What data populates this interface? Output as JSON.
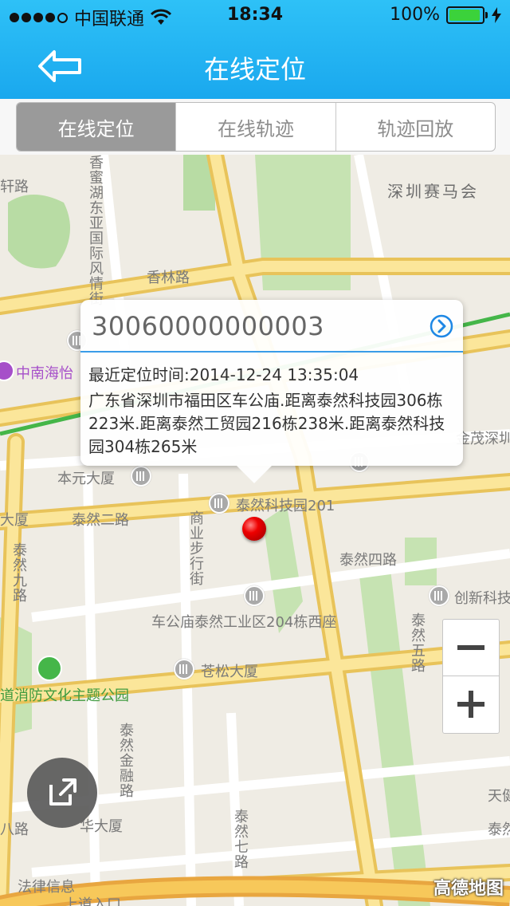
{
  "status_bar": {
    "carrier": "中国联通",
    "time": "18:34",
    "battery": "100%"
  },
  "nav": {
    "title": "在线定位",
    "back_icon": "back-arrow-icon"
  },
  "tabs": [
    {
      "label": "在线定位",
      "active": true
    },
    {
      "label": "在线轨迹",
      "active": false
    },
    {
      "label": "轨迹回放",
      "active": false
    }
  ],
  "popup": {
    "device_id": "30060000000003",
    "time_label": "最近定位时间:2014-12-24 13:35:04",
    "address": "广东省深圳市福田区车公庙.距离泰然科技园306栋223米.距离泰然工贸园216栋238米.距离泰然科技园304栋265米"
  },
  "map_labels": {
    "jockey_club": "深圳赛马会",
    "xianglin": "香林路",
    "xiang_mi": "香蜜湖东亚国际风情街",
    "xuan_road": "轩路",
    "zhongnan": "中南海怡",
    "jinmao": "金茂深圳",
    "benyuan": "本元大厦",
    "tairan_keji": "泰然科技园201",
    "tairan_2": "泰然二路",
    "dasha": "大厦",
    "tairan_9": "泰然九路",
    "shangye": "商业步行街",
    "tairan_4": "泰然四路",
    "chuangxin": "创新科技",
    "chegongmiao": "车公庙泰然工业区204栋西座",
    "tairan_5": "泰然五路",
    "cangsong": "苍松大厦",
    "xiaofang": "道消防文化主题公园",
    "jinrong": "泰然金融路",
    "huahua": "华大厦",
    "tairan_7": "泰然七路",
    "tairan_8": "八路",
    "tianjian": "天健",
    "tairan_r": "泰然",
    "falv": "法律信息",
    "entrance": "上道入口"
  },
  "logo": "高德地图",
  "colors": {
    "header": "#1aa8ee",
    "accent": "#3a9ce8",
    "pin": "#e00000",
    "major_road": "#fbd85e",
    "green": "#7bc96f"
  },
  "icons": {
    "zoom_out": "minus-icon",
    "zoom_in": "plus-icon",
    "share": "share-icon",
    "detail": "chevron-right-circle-icon"
  }
}
